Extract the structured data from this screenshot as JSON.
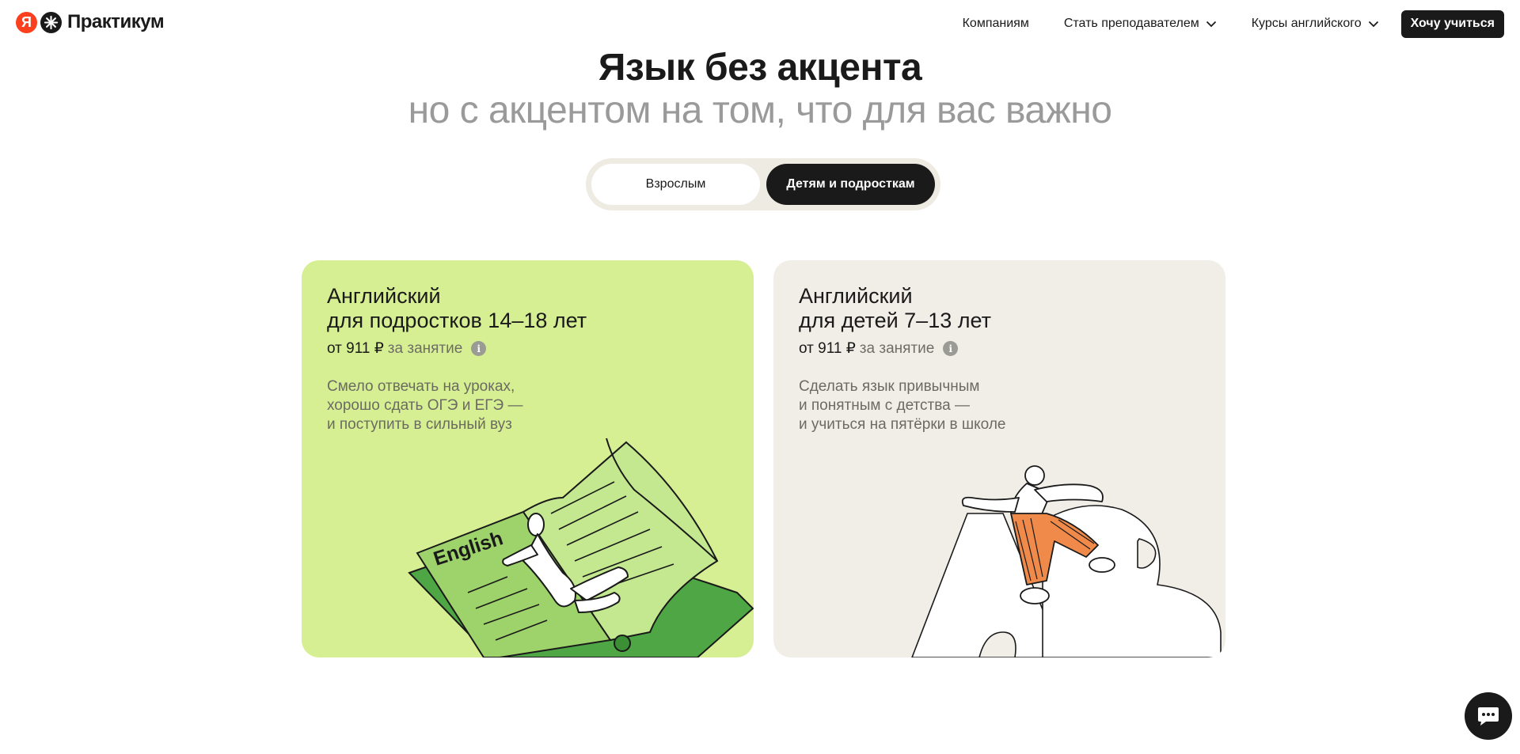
{
  "brand": {
    "logo_letter": "Я",
    "name": "Практикум"
  },
  "nav": {
    "items": [
      {
        "label": "Компаниям"
      },
      {
        "label": "Стать преподавателем"
      },
      {
        "label": "Курсы английского"
      }
    ],
    "cta_label": "Хочу учиться"
  },
  "hero": {
    "title": "Язык без акцента",
    "subtitle": "но с акцентом на том, что для вас важно"
  },
  "audience_switch": {
    "options": [
      {
        "label": "Взрослым"
      },
      {
        "label": "Детям и подросткам"
      }
    ],
    "selected": "Детям и подросткам"
  },
  "cards": [
    {
      "title_line1": "Английский",
      "title_line2": "для подростков 14–18 лет",
      "price": "от 911 ₽",
      "price_unit": "за занятие",
      "desc_line1": "Смело отвечать на уроках,",
      "desc_line2": "хорошо сдать ОГЭ и ЕГЭ —",
      "desc_line3": "и поступить в сильный вуз",
      "illustration_label": "English"
    },
    {
      "title_line1": "Английский",
      "title_line2": "для детей 7–13 лет",
      "price": "от 911 ₽",
      "price_unit": "за занятие",
      "desc_line1": "Сделать язык привычным",
      "desc_line2": "и понятным с детства —",
      "desc_line3": "и учиться на пятёрки в школе"
    }
  ],
  "colors": {
    "card_teen_bg": "#d6ef92",
    "card_kids_bg": "#f1eee8",
    "accent_orange": "#f08a4b",
    "book_green": "#4ea645",
    "logo_red": "#fc3f1d"
  },
  "icons": [
    "star-logo-icon",
    "chevron-down-icon",
    "info-icon",
    "chat-icon"
  ]
}
